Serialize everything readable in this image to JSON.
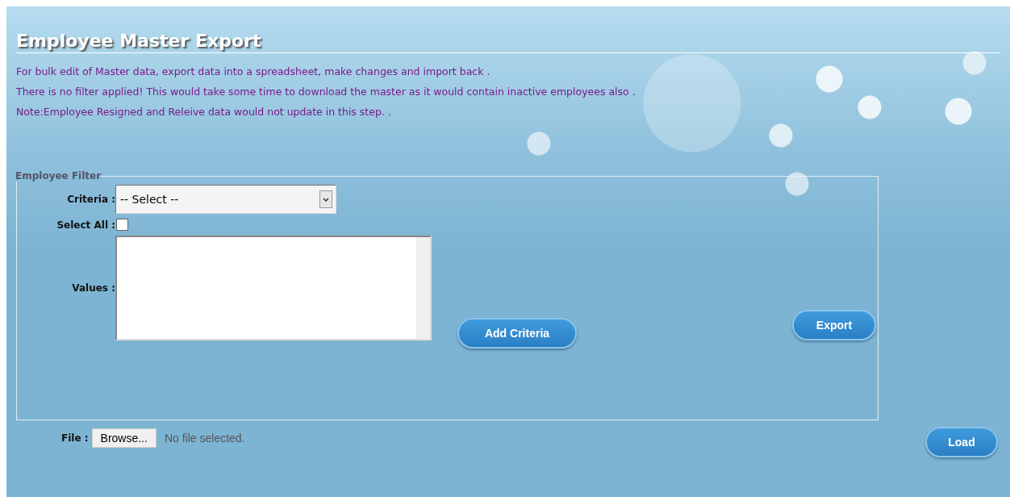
{
  "page": {
    "title": "Employee Master Export"
  },
  "notes": [
    "For bulk edit of Master data, export data into a spreadsheet, make changes and import back .",
    "There is no filter applied! This would take some time to download the master as it would contain inactive employees also .",
    "Note:Employee Resigned and Releive data would not update in this step. ."
  ],
  "filter": {
    "legend": "Employee Filter",
    "criteria": {
      "label": "Criteria :",
      "value": "-- Select --"
    },
    "select_all": {
      "label": "Select All :",
      "checked": false
    },
    "values": {
      "label": "Values :"
    },
    "add_button": "Add Criteria",
    "export_button": "Export"
  },
  "file": {
    "label": "File :",
    "browse_button": "Browse...",
    "status": "No file selected."
  },
  "load_button": "Load"
}
